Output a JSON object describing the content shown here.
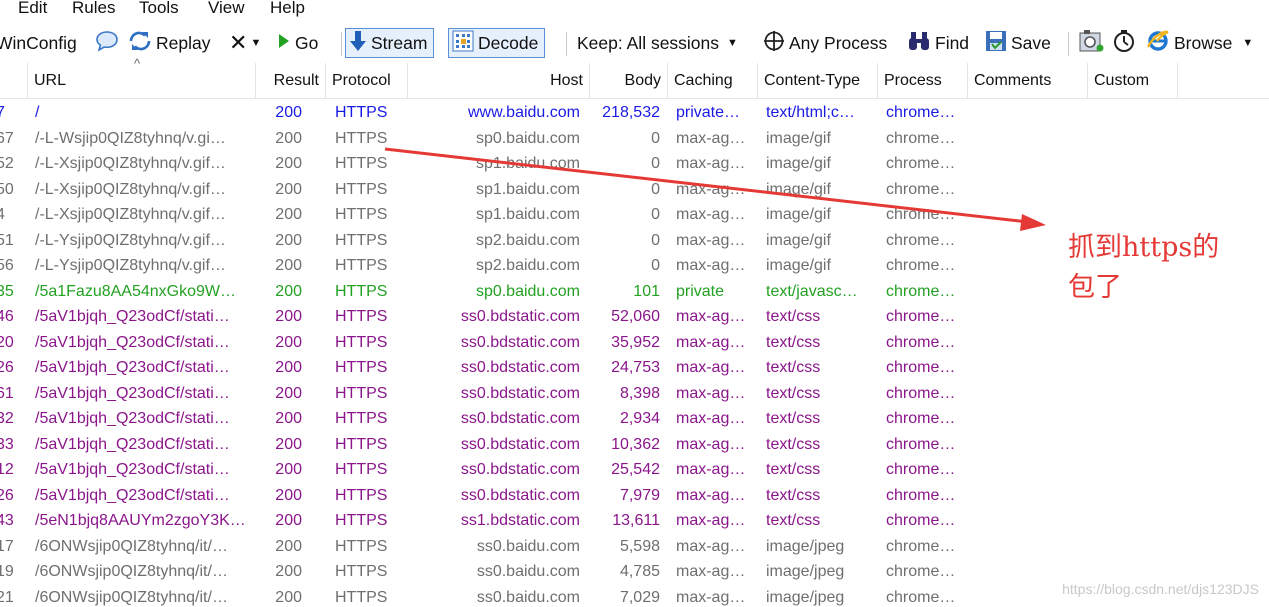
{
  "menu": [
    "Edit",
    "Rules",
    "Tools",
    "View",
    "Help"
  ],
  "toolbar": {
    "winconfig": "WinConfig",
    "replay": "Replay",
    "remove": "✕",
    "go": "Go",
    "stream": "Stream",
    "decode": "Decode",
    "keep": "Keep: All sessions",
    "process": "Any Process",
    "find": "Find",
    "save": "Save",
    "browse": "Browse"
  },
  "columns": [
    "URL",
    "Result",
    "Protocol",
    "Host",
    "Body",
    "Caching",
    "Content-Type",
    "Process",
    "Comments",
    "Custom"
  ],
  "colors": {
    "black": "#1c1c1c",
    "blue": "#1a1ae6",
    "gray": "#6f6f6f",
    "green": "#23a123",
    "purple": "#8b168b",
    "annotation": "#e53935"
  },
  "rows": [
    {
      "num": "7",
      "url": "/",
      "result": "200",
      "protocol": "HTTPS",
      "host": "www.baidu.com",
      "body": "218,532",
      "caching": "private…",
      "ctype": "text/html;c…",
      "process": "chrome…",
      "color": "blue"
    },
    {
      "num": "67",
      "url": "/-L-Wsjip0QIZ8tyhnq/v.gi…",
      "result": "200",
      "protocol": "HTTPS",
      "host": "sp0.baidu.com",
      "body": "0",
      "caching": "max-ag…",
      "ctype": "image/gif",
      "process": "chrome…",
      "color": "gray"
    },
    {
      "num": "52",
      "url": "/-L-Xsjip0QIZ8tyhnq/v.gif…",
      "result": "200",
      "protocol": "HTTPS",
      "host": "sp1.baidu.com",
      "body": "0",
      "caching": "max-ag…",
      "ctype": "image/gif",
      "process": "chrome…",
      "color": "gray"
    },
    {
      "num": "50",
      "url": "/-L-Xsjip0QIZ8tyhnq/v.gif…",
      "result": "200",
      "protocol": "HTTPS",
      "host": "sp1.baidu.com",
      "body": "0",
      "caching": "max-ag…",
      "ctype": "image/gif",
      "process": "chrome…",
      "color": "gray"
    },
    {
      "num": "4",
      "url": "/-L-Xsjip0QIZ8tyhnq/v.gif…",
      "result": "200",
      "protocol": "HTTPS",
      "host": "sp1.baidu.com",
      "body": "0",
      "caching": "max-ag…",
      "ctype": "image/gif",
      "process": "chrome…",
      "color": "gray"
    },
    {
      "num": "51",
      "url": "/-L-Ysjip0QIZ8tyhnq/v.gif…",
      "result": "200",
      "protocol": "HTTPS",
      "host": "sp2.baidu.com",
      "body": "0",
      "caching": "max-ag…",
      "ctype": "image/gif",
      "process": "chrome…",
      "color": "gray"
    },
    {
      "num": "56",
      "url": "/-L-Ysjip0QIZ8tyhnq/v.gif…",
      "result": "200",
      "protocol": "HTTPS",
      "host": "sp2.baidu.com",
      "body": "0",
      "caching": "max-ag…",
      "ctype": "image/gif",
      "process": "chrome…",
      "color": "gray"
    },
    {
      "num": "35",
      "url": "/5a1Fazu8AA54nxGko9W…",
      "result": "200",
      "protocol": "HTTPS",
      "host": "sp0.baidu.com",
      "body": "101",
      "caching": "private",
      "ctype": "text/javasc…",
      "process": "chrome…",
      "color": "green"
    },
    {
      "num": "46",
      "url": "/5aV1bjqh_Q23odCf/stati…",
      "result": "200",
      "protocol": "HTTPS",
      "host": "ss0.bdstatic.com",
      "body": "52,060",
      "caching": "max-ag…",
      "ctype": "text/css",
      "process": "chrome…",
      "color": "purple"
    },
    {
      "num": "20",
      "url": "/5aV1bjqh_Q23odCf/stati…",
      "result": "200",
      "protocol": "HTTPS",
      "host": "ss0.bdstatic.com",
      "body": "35,952",
      "caching": "max-ag…",
      "ctype": "text/css",
      "process": "chrome…",
      "color": "purple"
    },
    {
      "num": "26",
      "url": "/5aV1bjqh_Q23odCf/stati…",
      "result": "200",
      "protocol": "HTTPS",
      "host": "ss0.bdstatic.com",
      "body": "24,753",
      "caching": "max-ag…",
      "ctype": "text/css",
      "process": "chrome…",
      "color": "purple"
    },
    {
      "num": "61",
      "url": "/5aV1bjqh_Q23odCf/stati…",
      "result": "200",
      "protocol": "HTTPS",
      "host": "ss0.bdstatic.com",
      "body": "8,398",
      "caching": "max-ag…",
      "ctype": "text/css",
      "process": "chrome…",
      "color": "purple"
    },
    {
      "num": "32",
      "url": "/5aV1bjqh_Q23odCf/stati…",
      "result": "200",
      "protocol": "HTTPS",
      "host": "ss0.bdstatic.com",
      "body": "2,934",
      "caching": "max-ag…",
      "ctype": "text/css",
      "process": "chrome…",
      "color": "purple"
    },
    {
      "num": "33",
      "url": "/5aV1bjqh_Q23odCf/stati…",
      "result": "200",
      "protocol": "HTTPS",
      "host": "ss0.bdstatic.com",
      "body": "10,362",
      "caching": "max-ag…",
      "ctype": "text/css",
      "process": "chrome…",
      "color": "purple"
    },
    {
      "num": "12",
      "url": "/5aV1bjqh_Q23odCf/stati…",
      "result": "200",
      "protocol": "HTTPS",
      "host": "ss0.bdstatic.com",
      "body": "25,542",
      "caching": "max-ag…",
      "ctype": "text/css",
      "process": "chrome…",
      "color": "purple"
    },
    {
      "num": "26",
      "url": "/5aV1bjqh_Q23odCf/stati…",
      "result": "200",
      "protocol": "HTTPS",
      "host": "ss0.bdstatic.com",
      "body": "7,979",
      "caching": "max-ag…",
      "ctype": "text/css",
      "process": "chrome…",
      "color": "purple"
    },
    {
      "num": "43",
      "url": "/5eN1bjq8AAUYm2zgoY3K…",
      "result": "200",
      "protocol": "HTTPS",
      "host": "ss1.bdstatic.com",
      "body": "13,611",
      "caching": "max-ag…",
      "ctype": "text/css",
      "process": "chrome…",
      "color": "purple"
    },
    {
      "num": "17",
      "url": "/6ONWsjip0QIZ8tyhnq/it/…",
      "result": "200",
      "protocol": "HTTPS",
      "host": "ss0.baidu.com",
      "body": "5,598",
      "caching": "max-ag…",
      "ctype": "image/jpeg",
      "process": "chrome…",
      "color": "gray"
    },
    {
      "num": "19",
      "url": "/6ONWsjip0QIZ8tyhnq/it/…",
      "result": "200",
      "protocol": "HTTPS",
      "host": "ss0.baidu.com",
      "body": "4,785",
      "caching": "max-ag…",
      "ctype": "image/jpeg",
      "process": "chrome…",
      "color": "gray"
    },
    {
      "num": "21",
      "url": "/6ONWsjip0QIZ8tyhnq/it/…",
      "result": "200",
      "protocol": "HTTPS",
      "host": "ss0.baidu.com",
      "body": "7,029",
      "caching": "max-ag…",
      "ctype": "image/jpeg",
      "process": "chrome…",
      "color": "gray"
    }
  ],
  "annotation": {
    "line1": "抓到https的",
    "line2": "包了"
  },
  "watermark": "https://blog.csdn.net/djs123DJS"
}
